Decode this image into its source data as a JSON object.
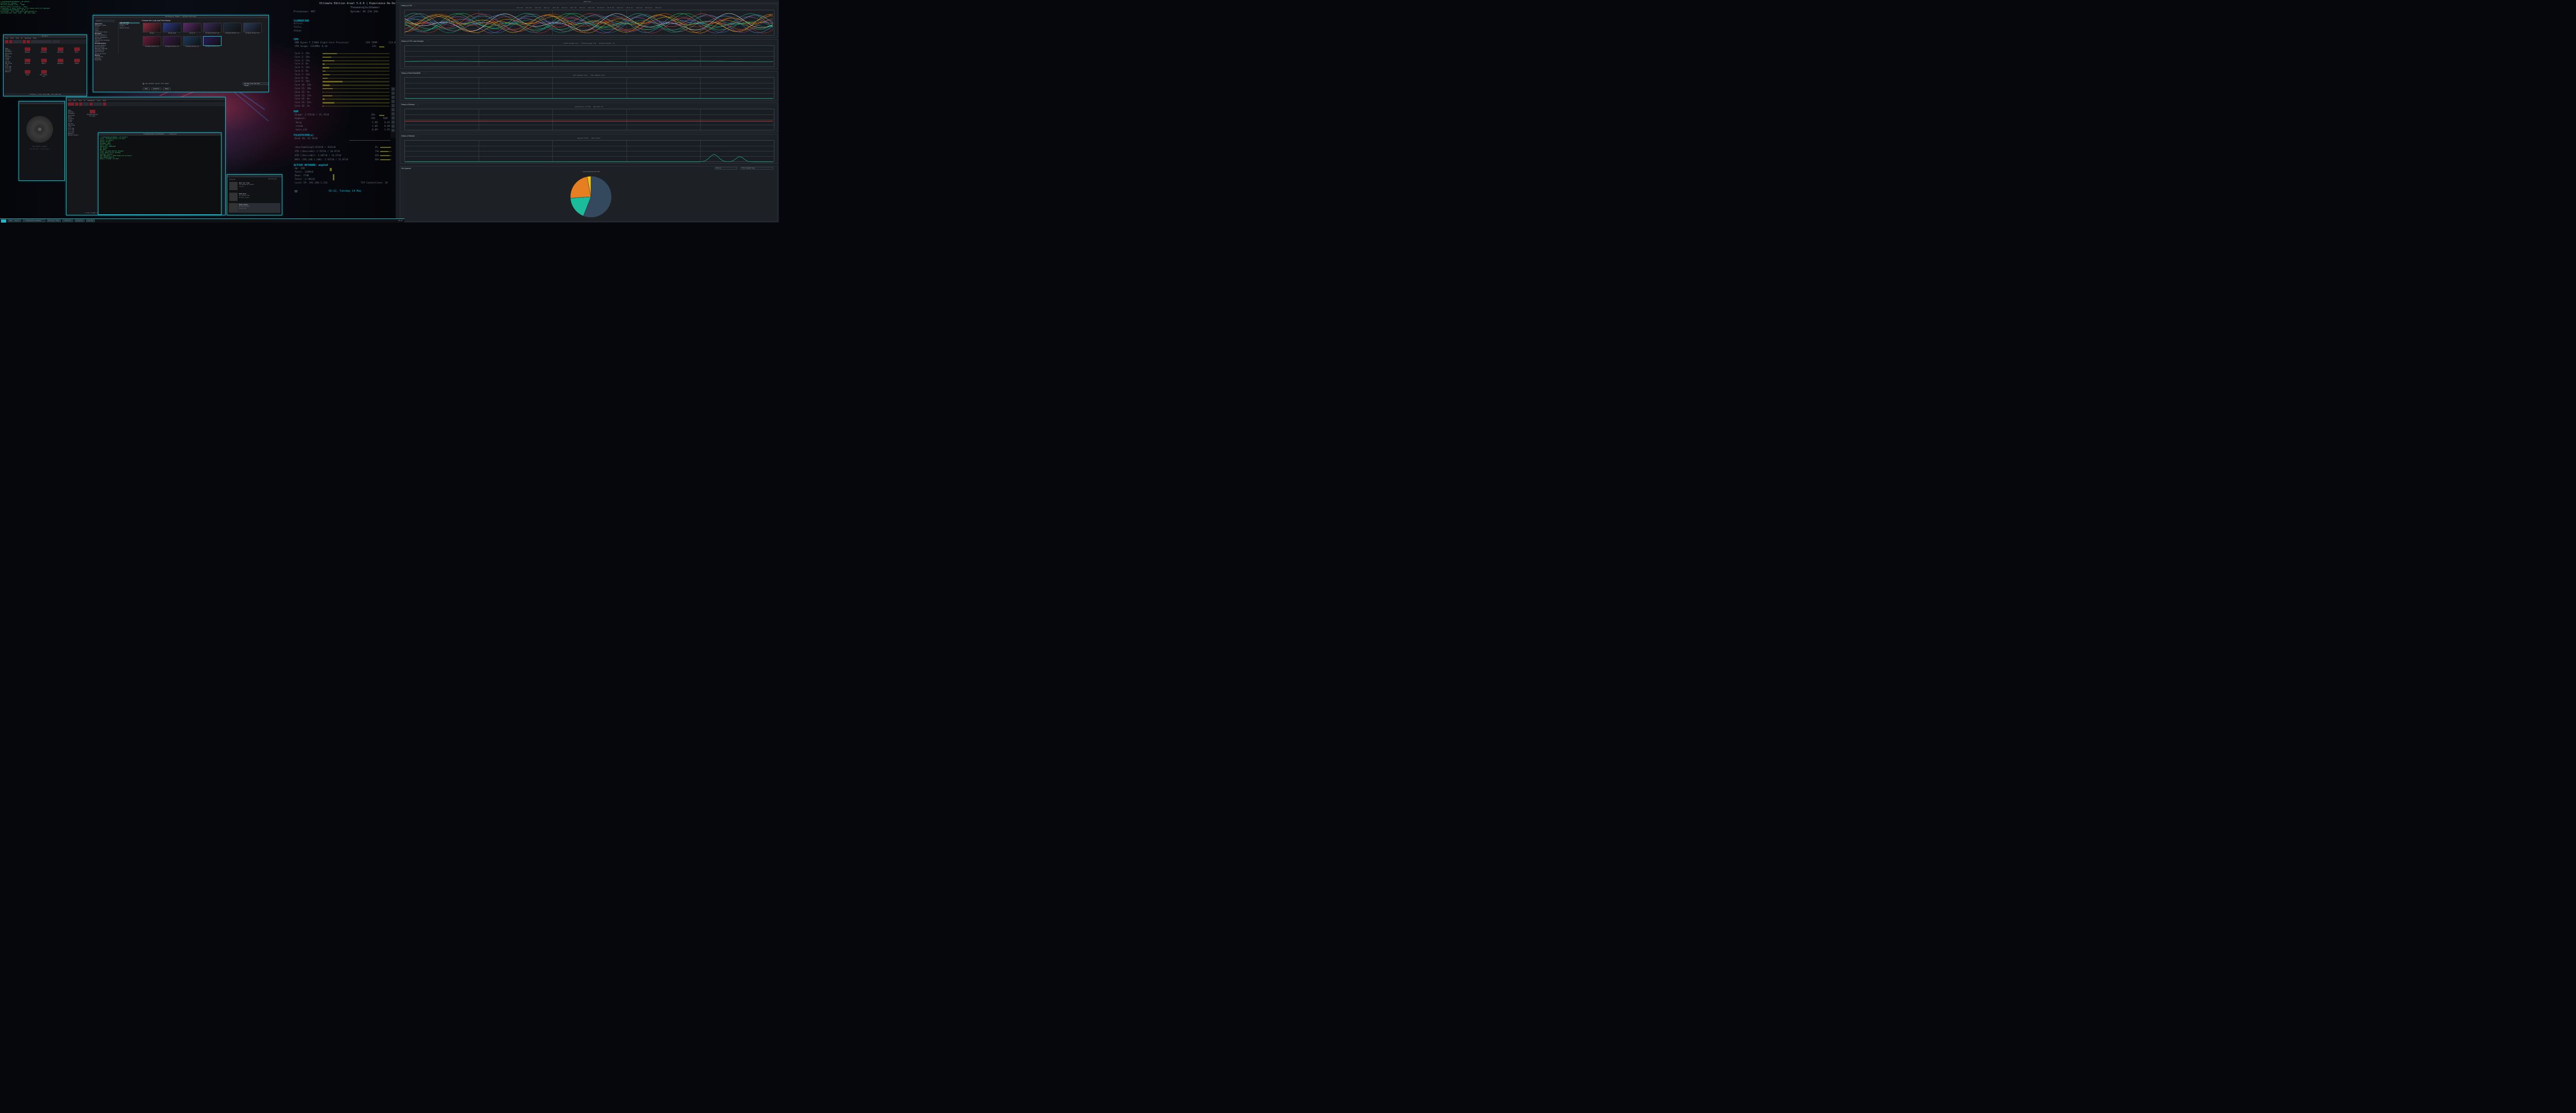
{
  "wallpaper": {
    "title": "Ultimate Edition Arael 5.0.0 | Experience Re-Deif"
  },
  "terminal_top": {
    "lines": [
      "[root@TheemahnJackHammer ~]# updates",
      "Checking for updates... ok",
      "Fetching package lists... DONE",
      "Reading state information... Done",
      "0 upgraded, 0 newly installed, 0 to remove and 0 not upgraded.",
      "",
      "[root@TheemahnJackHammer ~]# df -h",
      "Filesystem   Size  Used Avail Use% Mounted on",
      "/dev/nvme1n1p5  452G  412G   40G  92% /home"
    ]
  },
  "file_manager_1": {
    "title": "Dolphin",
    "statusbar": "7 Folders, 1 File (21.0 KiB), 20.4 GiB free",
    "sidebar": [
      "Home",
      "Desktop",
      "Documents",
      "Downloads",
      "Music",
      "Pictures",
      "Videos",
      "Trash",
      "Devices",
      "452.0 GiB",
      "2 TB",
      "10.9 GiB",
      "14.6 GiB",
      "21.8 GiB",
      "Network"
    ],
    "files": [
      "Desktop",
      "Documents",
      "Downloads",
      "Music",
      "Pictures",
      "Public",
      "Templates",
      "Videos",
      "conky",
      "umix-folder-icon"
    ]
  },
  "settings": {
    "title": "Workspace Theme — System Settings",
    "search": "Search",
    "sections": [
      "Appearance",
      "Workspace Theme",
      "Colors",
      "Fonts",
      "Icons",
      "Application Style",
      "Workspace",
      "Desktop Behavior",
      "Window Management",
      "Shortcuts",
      "Startup and Shutdown",
      "Search",
      "Personalization",
      "Account Details",
      "Notifications",
      "Regional Settings",
      "Accessibility",
      "Applications",
      "Online Accounts",
      "Network",
      "Connections",
      "Settings",
      "Bluetooth"
    ],
    "subnav": [
      "Look and Feel",
      "Plasma Theme",
      "Cursors",
      "Splash Screen"
    ],
    "heading": "Choose the Look and Feel theme",
    "themes": [
      "Breeze",
      "Breeze Dark",
      "Fusion 9",
      "Ultimate Edition 5.0",
      "Ultimate Edition 5.1",
      "Ultimate Edition 6.0",
      "Ultimate Edition 6.1",
      "Ultimate Edition 6.2",
      "Ultimate Edition 6.3",
      "Ultimate Edition 6.4"
    ],
    "checkbox": "Use desktop layout from theme",
    "get_new": "Get New Look and Feel Themes...",
    "buttons": [
      "Help",
      "Defaults",
      "Reset"
    ]
  },
  "music_player": {
    "artist_placeholder": "The album is empty",
    "album_hint": "Add some music to this player"
  },
  "file_manager_2": {
    "statusbar": "1 File (1 KiB), 20.4 GiB free",
    "item": "Ultimate Edition 5.0 Arael",
    "sidebar": [
      "Home",
      "Desktop",
      "Documents",
      "Downloads",
      "Music",
      "Pictures",
      "Videos",
      "Trash",
      "Devices",
      "452.0 GiB",
      "2 TB",
      "10.9 GiB",
      "14.6 GiB",
      "21.8 GiB",
      "Network",
      "Shared Folders"
    ]
  },
  "terminal_mid": {
    "title": "root@TheemahnJackHammer: ~ — Konsole",
    "lines": [
      "[root@TheemahnJackHammer ~]# neofetch",
      "Linux - Ultimate Edition 5.0 Arael",
      "Kernel: 5.x-generic",
      "Uptime: 9h 27m",
      "Packages: 4012",
      "Shell: bash 5.1",
      "Resolution: 7560x2160",
      "DE: Plasma",
      "WM: KWin",
      "Theme: Ultimate Edition [Plasma]",
      "Icons: Numix-Circle [Plasma]",
      "Terminal: konsole",
      "CPU: AMD Ryzen 7 1700X Eight-Core Processor",
      "GPU: NVIDIA GeForce",
      "Memory: 2.57GiB / 15.7GiB"
    ]
  },
  "mini_player": {
    "tracks": [
      {
        "title": "Wait My Time",
        "artist": "The Butterfly Effect",
        "album": "Fiction"
      },
      {
        "title": "Reminded",
        "artist": "In Coming Free",
        "album": "Northern Lights"
      },
      {
        "title": "Dead Sands",
        "artist": "In Mirror Exit",
        "album": "Rising Star"
      }
    ],
    "queue": "Now Playing"
  },
  "conky": {
    "title": "Ultimate Edition Arael 5.0.0 | Experience Re-Deif",
    "user": "Theemahn@JackHammer",
    "uptime": "Uptime: 0h 27m 24s",
    "processes": "Processes: 407",
    "player_head": "CLEMENTINE",
    "artist": "Artist:",
    "title_lbl": "Title:",
    "album": "Album:",
    "cpu_head": "CPU",
    "cpu_model": "AMD Ryzen 7 1700X Eight-Core Processor",
    "cpu_usage": "CPU Usage: 2323MHz 8.18",
    "cpu_temp_lbl": "CPU TEMP:",
    "cpu_temp": "113.0°F",
    "cpu_pct": "13%",
    "cores": [
      {
        "label": "Core 1: 25%",
        "v": 25
      },
      {
        "label": "Core 2: 15%",
        "v": 15
      },
      {
        "label": "Core 3: 21%",
        "v": 21
      },
      {
        "label": "Core 4: 4%",
        "v": 4
      },
      {
        "label": "Core 5: 12%",
        "v": 12
      },
      {
        "label": "Core 6: 5%",
        "v": 5
      },
      {
        "label": "Core 7: 13%",
        "v": 13
      },
      {
        "label": "Core 8: 9%",
        "v": 9
      },
      {
        "label": "Core 9: 35%",
        "v": 35
      },
      {
        "label": "Core 10: 13%",
        "v": 13
      },
      {
        "label": "Core 11: 18%",
        "v": 18
      },
      {
        "label": "Core 12: 1%",
        "v": 1
      },
      {
        "label": "Core 13: 17%",
        "v": 17
      },
      {
        "label": "Core 14: 4%",
        "v": 4
      },
      {
        "label": "Core 15: 21%",
        "v": 21
      },
      {
        "label": "Core 16: 2%",
        "v": 2
      }
    ],
    "ram_head": "RAM",
    "ram_usage": "Usage: 2.57GiB / 15.7GiB",
    "ram_pct": "16%",
    "highest": "Highest:",
    "proc_cols": [
      "CPU",
      "RAM"
    ],
    "procs": [
      {
        "name": "Xorg",
        "cpu": "5.90",
        "ram": "0.02"
      },
      {
        "name": "steam",
        "cpu": "1.88",
        "ram": "0.88"
      },
      {
        "name": "kwin_x11",
        "cpu": "0.89",
        "ram": "1.95"
      }
    ],
    "fs_head": "FILESYSTEM(s)",
    "disk_io": "Disk IO: 61.1KiB",
    "mounts": [
      {
        "label": "/dev/home1n1p5:412GiB / 452GiB",
        "pct": "4%",
        "v": 92
      },
      {
        "label": "2TB (/dev/sda1) 2.76TiB / 10.9TiB",
        "pct": "74%",
        "v": 74
      },
      {
        "label": "6TB (/dev/sdb1): 2.60TiB / 14.6TiB",
        "pct": "82%",
        "v": 82
      },
      {
        "label": "NAS1 (192.168.1.100): 2.93TiB / 21.8TiB",
        "pct": "86%",
        "v": 86
      }
    ],
    "net_head": "ACTIVE NETWORK: enp5s0",
    "up": "Up: 32B",
    "total_up": "Total: 234MiB",
    "down": "Down: 279B",
    "total_down": "Total: 4.70GiB",
    "local_ip": "Local IP: 192.168.1.214",
    "tcp": "TCP Connections: 10",
    "datetime": "02:22, Tuesday 14 May"
  },
  "ksysguard": {
    "title": "Overview",
    "panels": [
      {
        "title": "History of CPU",
        "legend": [
          "CPU 1 25%",
          "CPU 2 15%",
          "CPU 3 21%",
          "CPU 4 4%",
          "CPU 5 12%",
          "CPU 6 5%",
          "CPU 7 13%",
          "CPU 8 9%",
          "CPU 9 35%",
          "CPU 10 13%",
          "CPU 11 18%",
          "CPU 12 1%",
          "CPU 13 17%",
          "CPU 14 4%",
          "CPU 15 21%",
          "CPU 16 2%"
        ]
      },
      {
        "title": "History of CPU Load Averages",
        "legend": [
          "1 Minute Average: 0.22",
          "5 Minute Average: 0.58",
          "15 Minute Average: 1.12"
        ]
      },
      {
        "title": "History of Disk Read/Write",
        "legend": [
          "Total Combined: 0 B/s",
          "Total Combined: 0 B/s"
        ]
      },
      {
        "title": "History of Memory",
        "legend": [
          "Used Physical: 2.57 GiB",
          "Used Swap: 0 B"
        ]
      },
      {
        "title": "History of Network",
        "legend": [
          "Received: 32 B/s",
          "Sent: 279 B/s"
        ]
      }
    ],
    "fs_title": "File Systems",
    "fs_legend": "/home/nvme1n1p5 452 GiB",
    "source": "Source",
    "type": "File System Type",
    "pie": [
      {
        "name": "used",
        "v": 56,
        "color": "#34495e"
      },
      {
        "name": "b",
        "v": 18,
        "color": "#1abc9c"
      },
      {
        "name": "c",
        "v": 23,
        "color": "#e67e22"
      },
      {
        "name": "d",
        "v": 3,
        "color": "#f1c40f"
      }
    ]
  },
  "taskbar": {
    "items": [
      "Home — Dolphin",
      "root@TheemahnJackHammer: ~",
      "Workspace Theme",
      "Clementine",
      "Ksysguard",
      "Overview"
    ],
    "clock": "02:22"
  }
}
